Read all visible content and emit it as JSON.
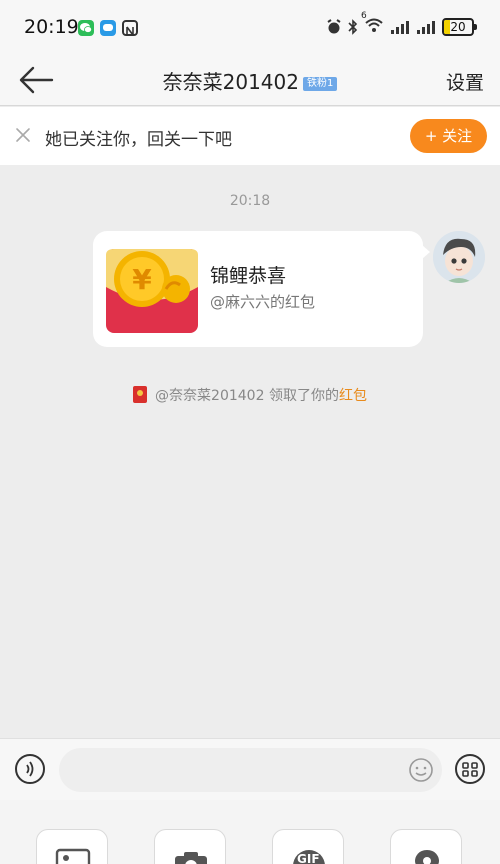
{
  "status": {
    "time": "20:19",
    "signal_label": "6",
    "battery": "20",
    "battery_level": 0.2
  },
  "nav": {
    "title": "奈奈菜201402",
    "badge": "铁粉1",
    "settings": "设置"
  },
  "follow_prompt": {
    "text": "她已关注你，回关一下吧",
    "button": "+ 关注"
  },
  "chat": {
    "time": "20:18",
    "redpacket": {
      "title": "锦鲤恭喜",
      "subtitle": "@麻六六的红包"
    },
    "system": {
      "prefix": "@奈奈菜201402 领取了你的",
      "highlight": "红包"
    }
  },
  "input": {
    "placeholder": ""
  },
  "tools": {
    "gif_label": "GIF"
  },
  "colors": {
    "accent": "#f8891d",
    "red_packet": "#e0314a"
  }
}
